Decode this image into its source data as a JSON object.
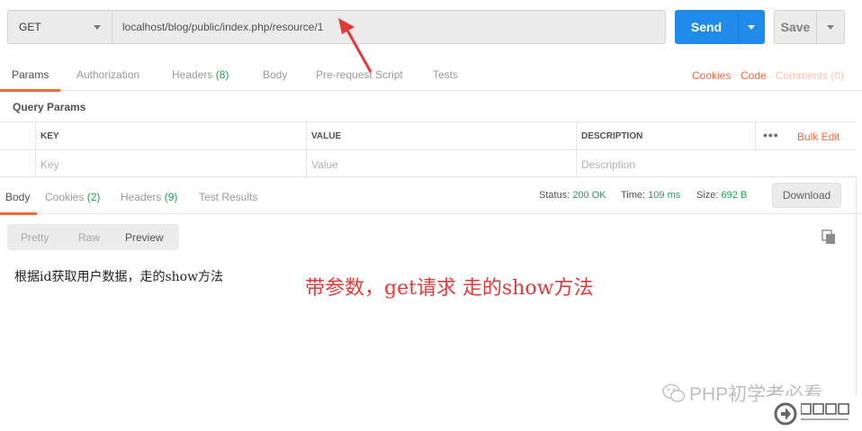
{
  "request": {
    "method": "GET",
    "url": "localhost/blog/public/index.php/resource/1",
    "send_label": "Send",
    "save_label": "Save"
  },
  "request_tabs": {
    "params": "Params",
    "authorization": "Authorization",
    "headers": "Headers",
    "headers_count": "(8)",
    "body": "Body",
    "prerequest": "Pre-request Script",
    "tests": "Tests",
    "cookies": "Cookies",
    "code": "Code",
    "comments": "Comments (0)"
  },
  "query_params": {
    "title": "Query Params",
    "columns": [
      "KEY",
      "VALUE",
      "DESCRIPTION"
    ],
    "placeholders": [
      "Key",
      "Value",
      "Description"
    ],
    "bulk_edit": "Bulk Edit",
    "more": "•••"
  },
  "response_tabs": {
    "body": "Body",
    "cookies": "Cookies",
    "cookies_count": "(2)",
    "headers": "Headers",
    "headers_count": "(9)",
    "test_results": "Test Results"
  },
  "status": {
    "status_label": "Status:",
    "status_value": "200 OK",
    "time_label": "Time:",
    "time_value": "109 ms",
    "size_label": "Size:",
    "size_value": "692 B",
    "download": "Download"
  },
  "view_modes": {
    "pretty": "Pretty",
    "raw": "Raw",
    "preview": "Preview",
    "active": "Preview"
  },
  "response_body": "根据id获取用户数据，走的show方法",
  "annotation": "带参数，get请求 走的show方法",
  "watermark": "PHP初学者必看",
  "colors": {
    "accent": "#f26b3a",
    "send": "#1f8ceb",
    "success": "#21a057",
    "annotation": "#e23a3a"
  },
  "icons": [
    "chevron-down-icon",
    "copy-icon",
    "wechat-icon",
    "red-arrow-icon"
  ]
}
